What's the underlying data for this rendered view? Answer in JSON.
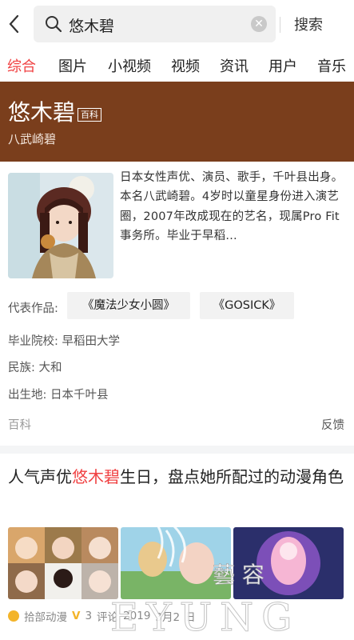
{
  "search": {
    "query": "悠木碧",
    "button_label": "搜索"
  },
  "tabs": [
    {
      "label": "综合",
      "active": true
    },
    {
      "label": "图片"
    },
    {
      "label": "小视频"
    },
    {
      "label": "视频"
    },
    {
      "label": "资讯"
    },
    {
      "label": "用户"
    },
    {
      "label": "音乐"
    }
  ],
  "profile": {
    "name": "悠木碧",
    "badge": "百科",
    "alias": "八武崎碧",
    "intro": "日本女性声优、演员、歌手，千叶县出身。本名八武崎碧。4岁时以童星身份进入演艺圈，2007年改成现在的艺名，现属Pro Fit事务所。毕业于早稻…",
    "works_label": "代表作品:",
    "works": [
      "《魔法少女小圆》",
      "《GOSICK》"
    ],
    "school": "毕业院校: 早稻田大学",
    "ethnicity": "民族: 大和",
    "birthplace": "出生地: 日本千叶县",
    "footer_source": "百科",
    "footer_feedback": "反馈"
  },
  "article": {
    "title_prefix": "人气声优",
    "title_highlight": "悠木碧",
    "title_suffix": "生日，盘点她所配过的动漫角色",
    "source": "拾部动漫",
    "comments": "3",
    "date": "2019",
    "comment_fragment": "评论",
    "date_fragment": "3月2",
    "date_tail": "日"
  },
  "watermark": {
    "text_latin": "EYUNG",
    "text_cjk": "藝 容"
  },
  "colors": {
    "accent": "#f04142",
    "hero_bg": "#7a3e1c"
  }
}
